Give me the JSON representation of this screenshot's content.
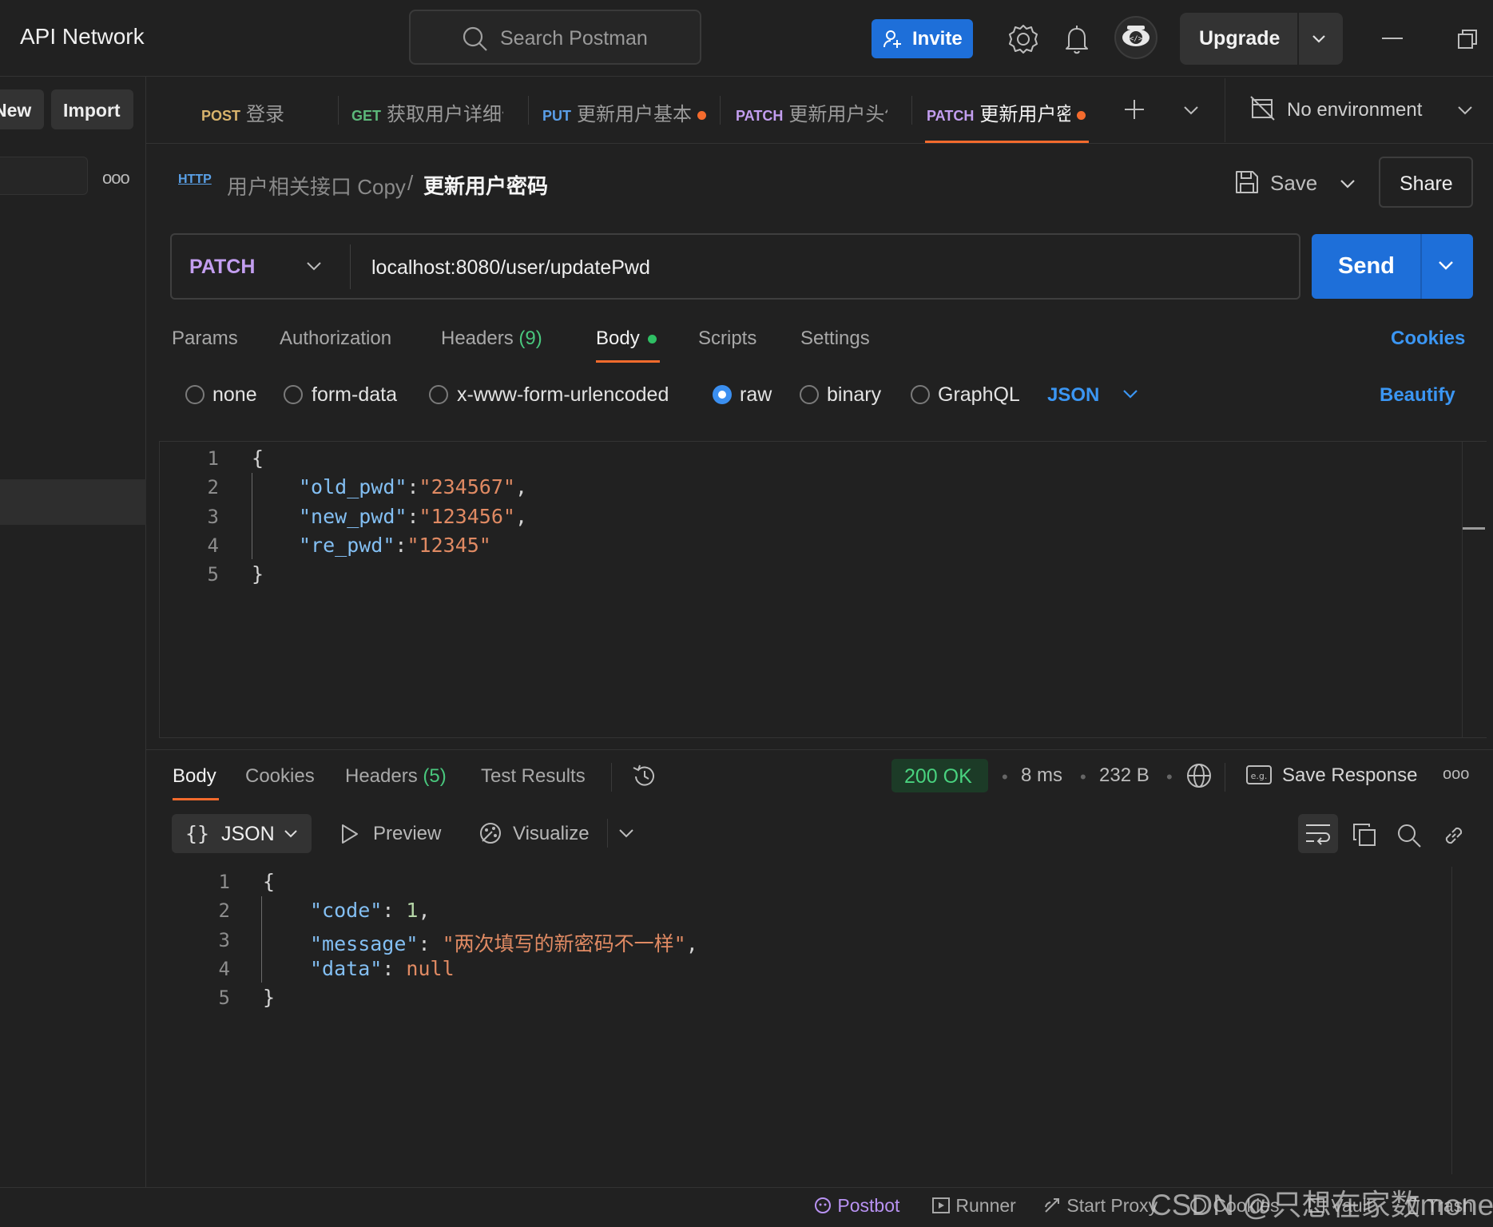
{
  "topbar": {
    "title": "API Network",
    "search_placeholder": "Search Postman",
    "invite_label": "Invite",
    "upgrade_label": "Upgrade"
  },
  "sidebar": {
    "new_label": "New",
    "import_label": "Import"
  },
  "tabs": [
    {
      "method": "POST",
      "name": "登录",
      "method_color": "#d8b36c",
      "unsaved": false,
      "active": false
    },
    {
      "method": "GET",
      "name": "获取用户详细信",
      "method_color": "#5cb87a",
      "unsaved": false,
      "active": false
    },
    {
      "method": "PUT",
      "name": "更新用户基本信",
      "method_color": "#5a9ee8",
      "unsaved": true,
      "active": false
    },
    {
      "method": "PATCH",
      "name": "更新用户头像",
      "method_color": "#c39ef0",
      "unsaved": false,
      "active": false
    },
    {
      "method": "PATCH",
      "name": "更新用户密码",
      "method_color": "#c39ef0",
      "unsaved": true,
      "active": true
    }
  ],
  "environment": {
    "label": "No environment"
  },
  "breadcrumb": {
    "icon_label": "HTTP",
    "parent": "用户相关接口 Copy",
    "separator": "/",
    "current": "更新用户密码"
  },
  "actions": {
    "save_label": "Save",
    "share_label": "Share",
    "send_label": "Send"
  },
  "request": {
    "method": "PATCH",
    "url": "localhost:8080/user/updatePwd",
    "tabs": {
      "params": "Params",
      "authorization": "Authorization",
      "headers": "Headers",
      "headers_count": "(9)",
      "body": "Body",
      "scripts": "Scripts",
      "settings": "Settings",
      "cookies": "Cookies"
    },
    "body_types": {
      "none": "none",
      "form_data": "form-data",
      "urlencoded": "x-www-form-urlencoded",
      "raw": "raw",
      "binary": "binary",
      "graphql": "GraphQL",
      "selected": "raw"
    },
    "language": "JSON",
    "beautify_label": "Beautify",
    "body_lines": {
      "n1": "1",
      "n2": "2",
      "n3": "3",
      "n4": "4",
      "n5": "5",
      "open": "{",
      "k1": "\"old_pwd\"",
      "v1": "\"234567\"",
      "k2": "\"new_pwd\"",
      "v2": "\"123456\"",
      "k3": "\"re_pwd\"",
      "v3": "\"12345\"",
      "close": "}"
    }
  },
  "response": {
    "tabs": {
      "body": "Body",
      "cookies": "Cookies",
      "headers": "Headers",
      "headers_count": "(5)",
      "test_results": "Test Results"
    },
    "status": "200 OK",
    "time": "8 ms",
    "size": "232 B",
    "save_response_label": "Save Response",
    "format": "JSON",
    "preview_label": "Preview",
    "visualize_label": "Visualize",
    "body_lines": {
      "n1": "1",
      "n2": "2",
      "n3": "3",
      "n4": "4",
      "n5": "5",
      "open": "{",
      "k1": "\"code\"",
      "v1": "1",
      "k2": "\"message\"",
      "v2": "\"两次填写的新密码不一样\"",
      "k3": "\"data\"",
      "v3": "null",
      "close": "}"
    }
  },
  "footer": {
    "postbot": "Postbot",
    "runner": "Runner",
    "start_proxy": "Start Proxy",
    "cookies": "Cookies",
    "vault": "Vault",
    "trash": "Trash"
  },
  "watermark": "CSDN @只想在家数money"
}
